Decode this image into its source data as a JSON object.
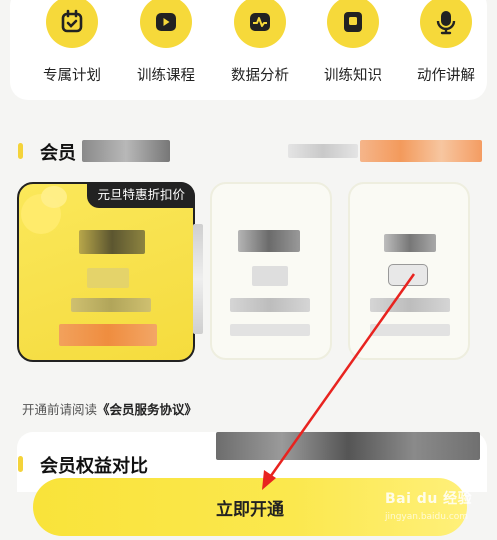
{
  "features": [
    {
      "label": "专属计划",
      "icon": "calendar-check-icon"
    },
    {
      "label": "训练课程",
      "icon": "play-icon"
    },
    {
      "label": "数据分析",
      "icon": "wave-chart-icon"
    },
    {
      "label": "训练知识",
      "icon": "book-icon"
    },
    {
      "label": "动作讲解",
      "icon": "microphone-icon"
    }
  ],
  "section_membership": {
    "title": "会员"
  },
  "plans": {
    "selected": {
      "badge": "元旦特惠折扣价"
    }
  },
  "agreement": {
    "prefix": "开通前请阅读",
    "link": "《会员服务协议》"
  },
  "section_benefits": {
    "title": "会员权益对比"
  },
  "cta": {
    "label": "立即开通"
  },
  "watermark": {
    "brand": "Bai du 经验",
    "sub": "jingyan.baidu.com"
  },
  "colors": {
    "accent": "#f6d93a",
    "annotation_arrow": "#e8231f"
  }
}
